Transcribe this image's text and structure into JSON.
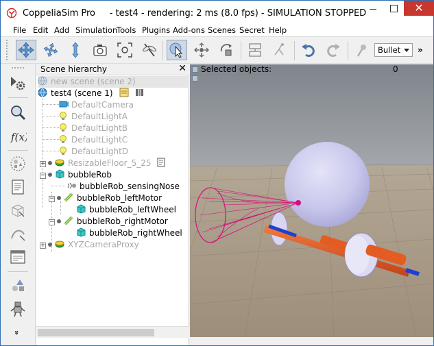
{
  "window": {
    "app_name": "CoppeliaSim Pro",
    "separator": "-",
    "scene_name": "test4",
    "status": "rendering: 2 ms (8.0 fps) - SIMULATION STOPPED",
    "close_glyph": "✕"
  },
  "menu": [
    "File",
    "Edit",
    "Add",
    "Simulation",
    "Tools",
    "Plugins",
    "Add-ons",
    "Scenes",
    "Secret",
    "Help"
  ],
  "toolbar": {
    "engine_select": "Bullet",
    "more": "»"
  },
  "left_toolbar": {
    "more": "»"
  },
  "hierarchy": {
    "title": "Scene hierarchy",
    "close_glyph": "✕",
    "items": [
      {
        "label": "new scene (scene 2)",
        "icon": "globe-icon"
      },
      {
        "label": "test4 (scene 1)",
        "icon": "globe-icon"
      },
      {
        "label": "DefaultCamera",
        "icon": "camera-icon"
      },
      {
        "label": "DefaultLightA",
        "icon": "light-icon"
      },
      {
        "label": "DefaultLightB",
        "icon": "light-icon"
      },
      {
        "label": "DefaultLightC",
        "icon": "light-icon"
      },
      {
        "label": "DefaultLightD",
        "icon": "light-icon"
      },
      {
        "label": "ResizableFloor_5_25",
        "icon": "floor-icon"
      },
      {
        "label": "bubbleRob",
        "icon": "shape-icon"
      },
      {
        "label": "bubbleRob_sensingNose",
        "icon": "proximity-sensor-icon"
      },
      {
        "label": "bubbleRob_leftMotor",
        "icon": "joint-icon"
      },
      {
        "label": "bubbleRob_leftWheel",
        "icon": "shape-icon"
      },
      {
        "label": "bubbleRob_rightMotor",
        "icon": "joint-icon"
      },
      {
        "label": "bubbleRob_rightWheel",
        "icon": "shape-icon"
      },
      {
        "label": "XYZCameraProxy",
        "icon": "dummy-icon"
      }
    ]
  },
  "viewport": {
    "selected_label": "Selected objects:",
    "selected_count": "0"
  },
  "colors": {
    "title_close": "#c7372f",
    "sphere": "#c9c8ec",
    "sensor": "#d0137a",
    "axle": "#e0561e",
    "wheel": "#d8d6f0",
    "sky": "#8f9397",
    "floor": "#a89a88"
  }
}
